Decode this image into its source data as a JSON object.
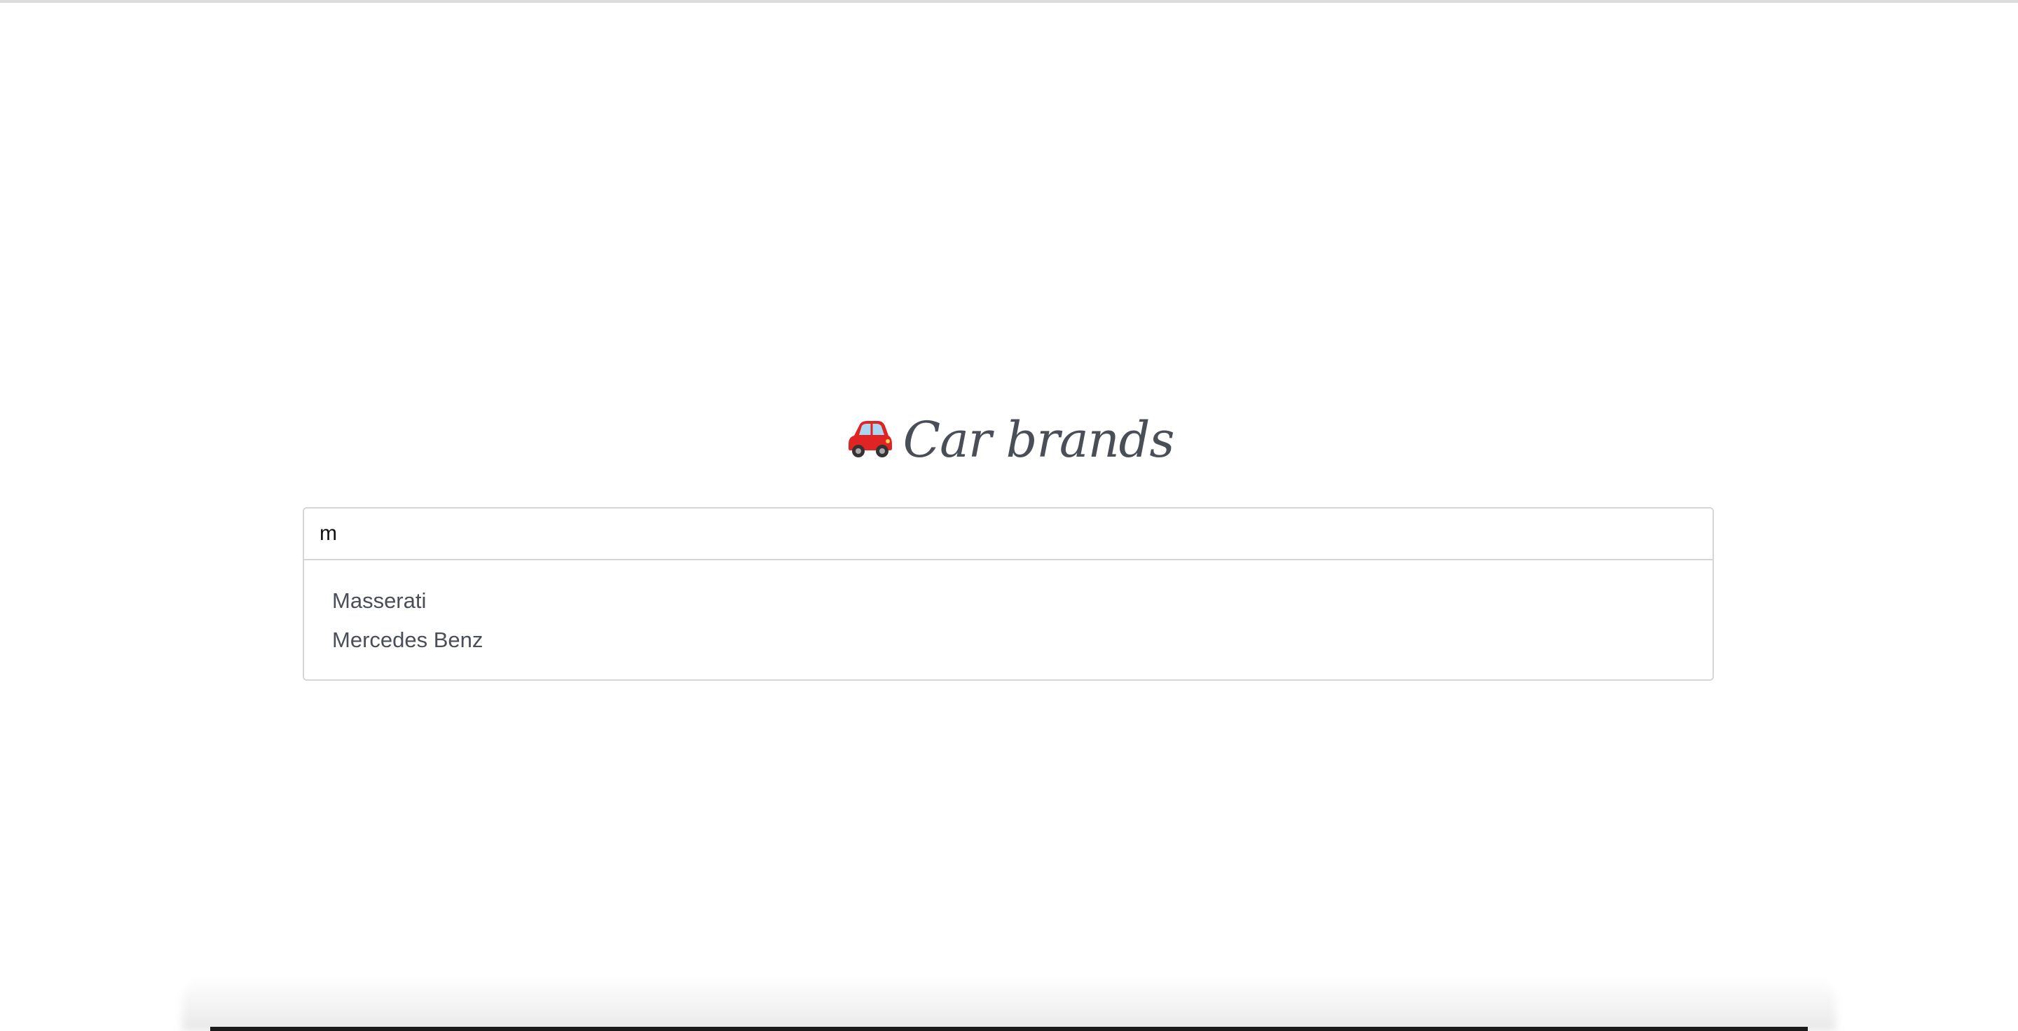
{
  "page": {
    "title_icon": "car-icon",
    "title": "Car brands"
  },
  "search": {
    "value": "m",
    "placeholder": ""
  },
  "suggestions": [
    {
      "label": "Masserati"
    },
    {
      "label": "Mercedes Benz"
    }
  ],
  "colors": {
    "text": "#4a4e57",
    "border": "#d6d6d6",
    "car_red": "#e02424"
  }
}
